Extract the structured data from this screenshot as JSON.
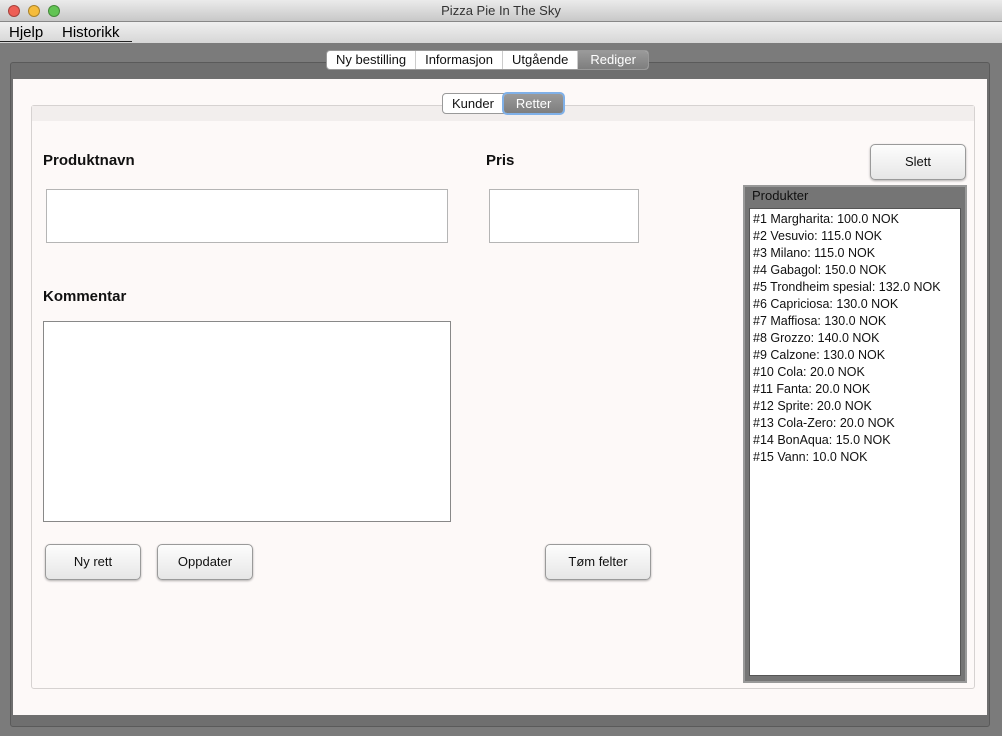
{
  "window": {
    "title": "Pizza Pie In The Sky"
  },
  "menu": [
    "Hjelp",
    "Historikk"
  ],
  "tabs": [
    {
      "label": "Ny bestilling"
    },
    {
      "label": "Informasjon"
    },
    {
      "label": "Utgående"
    },
    {
      "label": "Rediger",
      "selected": true
    }
  ],
  "subtabs": [
    {
      "label": "Kunder"
    },
    {
      "label": "Retter",
      "selected": true
    }
  ],
  "form": {
    "product_label": "Produktnavn",
    "product_value": "",
    "price_label": "Pris",
    "price_value": "",
    "comment_label": "Kommentar",
    "comment_value": ""
  },
  "buttons": {
    "new": "Ny rett",
    "update": "Oppdater",
    "clear": "Tøm felter",
    "delete": "Slett"
  },
  "products": {
    "title": "Produkter",
    "items": [
      "#1 Margharita: 100.0 NOK",
      "#2 Vesuvio: 115.0 NOK",
      "#3 Milano: 115.0 NOK",
      "#4 Gabagol: 150.0 NOK",
      "#5 Trondheim spesial: 132.0 NOK",
      "#6 Capriciosa: 130.0 NOK",
      "#7 Maffiosa: 130.0 NOK",
      "#8 Grozzo: 140.0 NOK",
      "#9 Calzone: 130.0 NOK",
      "#10 Cola: 20.0 NOK",
      "#11 Fanta: 20.0 NOK",
      "#12 Sprite: 20.0 NOK",
      "#13 Cola-Zero: 20.0 NOK",
      "#14 BonAqua: 15.0 NOK",
      "#15 Vann: 10.0 NOK"
    ]
  }
}
